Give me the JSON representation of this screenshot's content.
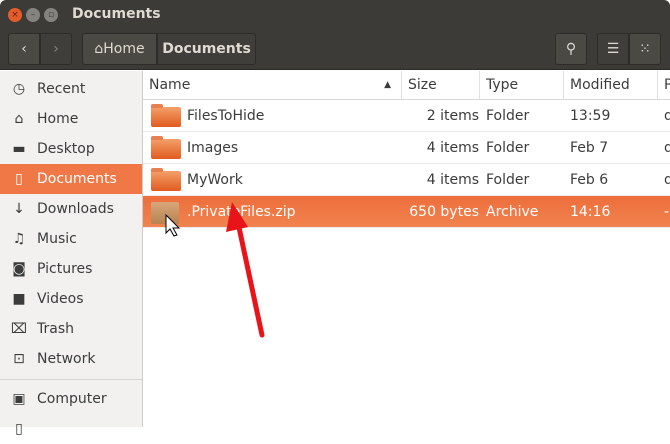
{
  "window": {
    "title": "Documents"
  },
  "toolbar": {
    "home": "Home",
    "current": "Documents"
  },
  "sidebar": {
    "items": [
      {
        "label": "Recent",
        "icon": "clock-icon"
      },
      {
        "label": "Home",
        "icon": "home-icon"
      },
      {
        "label": "Desktop",
        "icon": "folder-icon"
      },
      {
        "label": "Documents",
        "icon": "document-icon"
      },
      {
        "label": "Downloads",
        "icon": "download-icon"
      },
      {
        "label": "Music",
        "icon": "music-icon"
      },
      {
        "label": "Pictures",
        "icon": "camera-icon"
      },
      {
        "label": "Videos",
        "icon": "video-icon"
      },
      {
        "label": "Trash",
        "icon": "trash-icon"
      },
      {
        "label": "Network",
        "icon": "network-icon"
      },
      {
        "label": "Computer",
        "icon": "drive-icon"
      }
    ]
  },
  "columns": {
    "name": "Name",
    "size": "Size",
    "type": "Type",
    "modified": "Modified",
    "perm": "P"
  },
  "files": [
    {
      "name": "FilesToHide",
      "size": "2 items",
      "type": "Folder",
      "modified": "13:59",
      "perm": "d"
    },
    {
      "name": "Images",
      "size": "4 items",
      "type": "Folder",
      "modified": "Feb 7",
      "perm": "d"
    },
    {
      "name": "MyWork",
      "size": "4 items",
      "type": "Folder",
      "modified": "Feb 6",
      "perm": "d"
    },
    {
      "name": ".PrivateFiles.zip",
      "size": "650 bytes",
      "type": "Archive",
      "modified": "14:16",
      "perm": "-r"
    }
  ]
}
